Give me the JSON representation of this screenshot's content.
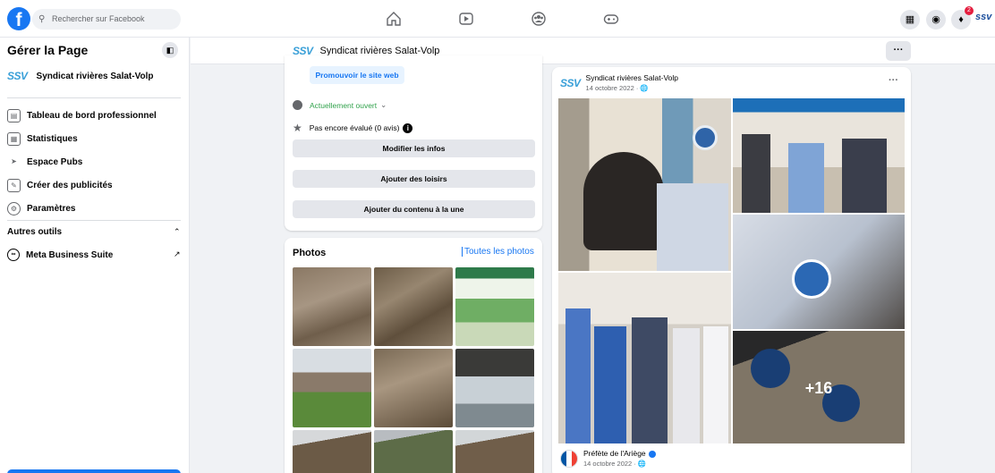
{
  "topbar": {
    "logo": "f",
    "search_placeholder": "Rechercher sur Facebook",
    "icons": [
      "home-icon",
      "video-icon",
      "groups-icon",
      "gaming-icon",
      "menu-grid-icon",
      "messenger-icon",
      "bell-icon"
    ],
    "notification_count": "2",
    "brand_color": "#1877f2"
  },
  "sidebar": {
    "title": "Gérer la Page",
    "page_logo_a": "SS",
    "page_logo_b": "V",
    "page_name": "Syndicat rivières Salat-Volp",
    "items": [
      {
        "label": "Tableau de bord professionnel",
        "icon": "dashboard-icon"
      },
      {
        "label": "Statistiques",
        "icon": "stats-icon"
      },
      {
        "label": "Espace Pubs",
        "icon": "megaphone-icon"
      },
      {
        "label": "Créer des publicités",
        "icon": "pencil-icon"
      },
      {
        "label": "Paramètres",
        "icon": "gear-icon"
      }
    ],
    "section_title": "Autres outils",
    "tools": [
      {
        "label": "Meta Business Suite",
        "icon": "meta-icon"
      }
    ]
  },
  "pagebar": {
    "page_name": "Syndicat rivières Salat-Volp",
    "more": "···"
  },
  "info_card": {
    "promo_label": "Promouvoir le site web",
    "open_status": "Actuellement ouvert",
    "rating": "Pas encore évalué (0 avis)",
    "buttons": [
      "Modifier les infos",
      "Ajouter des loisirs",
      "Ajouter du contenu à la une"
    ]
  },
  "photos_card": {
    "title": "Photos",
    "see_all": "Toutes les photos"
  },
  "post": {
    "author": "Syndicat rivières Salat-Volp",
    "date": "14 octobre 2022 · ",
    "more": "···",
    "extra_photos": "+16",
    "shared_author": "Préfète de l'Ariège",
    "shared_date": "14 octobre 2022 · "
  }
}
